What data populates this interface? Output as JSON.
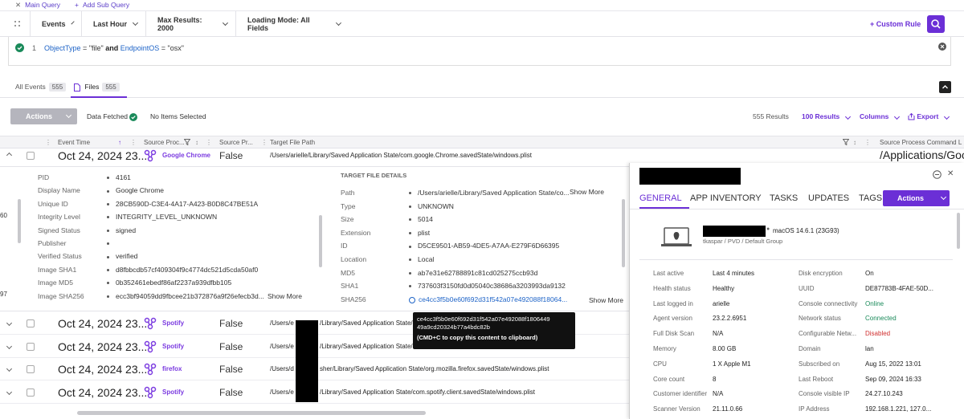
{
  "query_tabs": {
    "main": "Main Query",
    "add": "Add Sub Query"
  },
  "toolbar": {
    "events": "Events",
    "time": "Last Hour",
    "max": "Max Results: 2000",
    "loading": "Loading Mode: All Fields",
    "custom_rule": "+ Custom Rule"
  },
  "query": {
    "line_no": "1",
    "attr1": "ObjectType",
    "eq1": " = ",
    "val1": "\"file\"",
    "and": " and ",
    "attr2": "EndpointOS",
    "eq2": " = ",
    "val2": "\"osx\""
  },
  "tabs": {
    "all_events": "All Events",
    "all_events_count": "555",
    "files": "Files",
    "files_count": "555"
  },
  "actionbar": {
    "actions": "Actions",
    "data_fetched": "Data Fetched",
    "no_items": "No Items Selected",
    "results": "555 Results",
    "per_page": "100 Results",
    "columns": "Columns",
    "export": "Export"
  },
  "columns": {
    "event_time": "Event Time",
    "source_proc": "Source Proc...",
    "source_pr": "Source Pr...",
    "target_path": "Target File Path",
    "cmdline": "Source Process Command L"
  },
  "first_row": {
    "date": "Oct 24, 2024 23...",
    "app": "Google Chrome",
    "false": "False",
    "path": "/Users/arielle/Library/Saved Application State/com.google.Chrome.savedState/windows.plist",
    "cmd": "/Applications/Goo"
  },
  "left_details": [
    {
      "k": "PID",
      "v": "4161"
    },
    {
      "k": "Display Name",
      "v": "Google Chrome"
    },
    {
      "k": "Unique ID",
      "v": "28CB590D-C3E4-4A17-A423-B0D8C47BE51A"
    },
    {
      "k": "Integrity Level",
      "v": "INTEGRITY_LEVEL_UNKNOWN"
    },
    {
      "k": "Signed Status",
      "v": "signed"
    },
    {
      "k": "Publisher",
      "v": ""
    },
    {
      "k": "Verified Status",
      "v": "verified"
    },
    {
      "k": "Image SHA1",
      "v": "d8fbbcdb57cf409304f9c4774dc521d5cda50af0"
    },
    {
      "k": "Image MD5",
      "v": "0b352461ebedf86af2237a939dfbb105"
    },
    {
      "k": "Image SHA256",
      "v": "ecc3bf94059dd9fbcee21b372876a9f26efecb3d..."
    }
  ],
  "left_edge": {
    "a": "60",
    "b": "97"
  },
  "show_more": "Show More",
  "target_title": "TARGET FILE DETAILS",
  "target_details": [
    {
      "k": "Path",
      "v": "/Users/arielle/Library/Saved Application State/co..."
    },
    {
      "k": "Type",
      "v": "UNKNOWN"
    },
    {
      "k": "Size",
      "v": "5014"
    },
    {
      "k": "Extension",
      "v": "plist"
    },
    {
      "k": "ID",
      "v": "D5CE9501-AB59-4DE5-A7AA-E279F6D66395"
    },
    {
      "k": "Location",
      "v": "Local"
    },
    {
      "k": "MD5",
      "v": "ab7e31e62788891c81cd025275ccb93d"
    },
    {
      "k": "SHA1",
      "v": "737603f3150fd0d05040c38686a3203993da9132"
    },
    {
      "k": "SHA256",
      "v": "ce4cc3f5b0e60f692d31f542a07e492088f18064..."
    }
  ],
  "tooltip": {
    "line1": "ce4cc3f5b0e60f692d31f542a07e492088f1806449",
    "line2": "49a9cd20324b77a4bdc82b",
    "line3": "(CMD+C to copy this content to clipboard)"
  },
  "rows": [
    {
      "date": "Oct 24, 2024 23...",
      "app": "Spotify",
      "false": "False",
      "path_a": "/Users/e",
      "path_b": "/Library/Saved Application State/"
    },
    {
      "date": "Oct 24, 2024 23...",
      "app": "Spotify",
      "false": "False",
      "path_a": "/Users/e",
      "path_b": "/Library/Saved Application State/"
    },
    {
      "date": "Oct 24, 2024 23...",
      "app": "firefox",
      "false": "False",
      "path_a": "/Users/d",
      "path_b": "sher/Library/Saved Application State/org.mozilla.firefox.savedState/windows.plist"
    },
    {
      "date": "Oct 24, 2024 23...",
      "app": "Spotify",
      "false": "False",
      "path_a": "/Users/e",
      "path_b": "/Library/Saved Application State/com.spotify.client.savedState/windows.plist"
    }
  ],
  "panel": {
    "tabs": [
      "GENERAL",
      "APP INVENTORY",
      "TASKS",
      "UPDATES",
      "TAGS"
    ],
    "actions": "Actions",
    "os": "macOS 14.6.1 (23G93)",
    "site": "tkaspar / PVD / Default Group",
    "left": [
      {
        "k": "Last active",
        "v": "Last 4 minutes"
      },
      {
        "k": "Health status",
        "v": "Healthy"
      },
      {
        "k": "Last logged in",
        "v": "arielle"
      },
      {
        "k": "Agent version",
        "v": "23.2.2.6951"
      },
      {
        "k": "Full Disk Scan",
        "v": "N/A"
      },
      {
        "k": "Memory",
        "v": "8.00 GB"
      },
      {
        "k": "CPU",
        "v": "1 X Apple M1"
      },
      {
        "k": "Core count",
        "v": "8"
      },
      {
        "k": "Customer identifier",
        "v": "N/A"
      },
      {
        "k": "Scanner Version",
        "v": "21.11.0.66"
      }
    ],
    "right": [
      {
        "k": "Disk encryption",
        "v": "On"
      },
      {
        "k": "UUID",
        "v": "DE87783B-4FAE-50D..."
      },
      {
        "k": "Console connectivity",
        "v": "Online"
      },
      {
        "k": "Network status",
        "v": "Connected"
      },
      {
        "k": "Configurable Netw...",
        "v": "Disabled"
      },
      {
        "k": "Domain",
        "v": "lan"
      },
      {
        "k": "Subscribed on",
        "v": "Aug 15, 2022 13:01"
      },
      {
        "k": "Last Reboot",
        "v": "Sep 09, 2024 16:33"
      },
      {
        "k": "Console visible IP",
        "v": "24.27.10.243"
      },
      {
        "k": "IP Address",
        "v": "192.168.1.221, 127.0..."
      }
    ],
    "colors": {
      "online": "#1a8a5a",
      "connected": "#1a8a5a",
      "disabled": "#d03030"
    }
  }
}
